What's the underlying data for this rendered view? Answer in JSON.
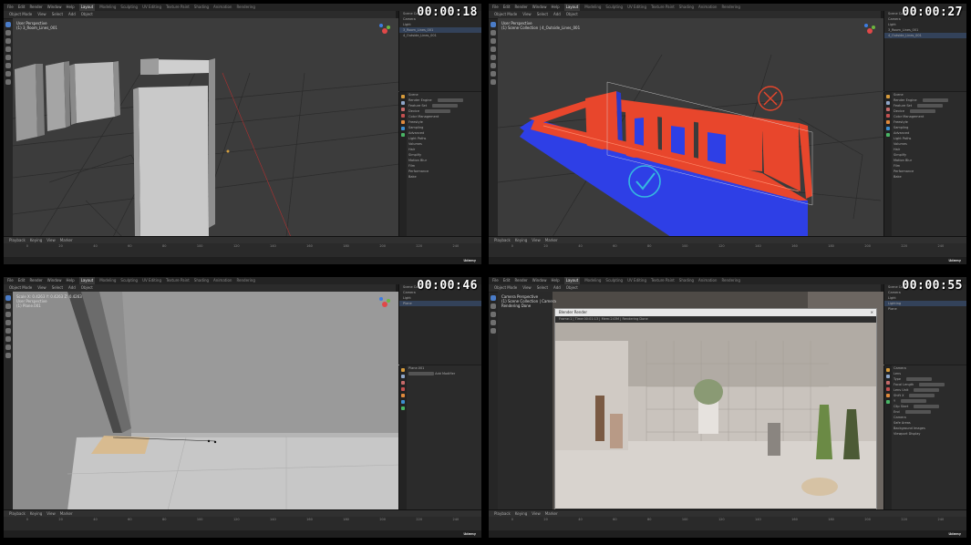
{
  "menus": [
    "File",
    "Edit",
    "Render",
    "Window",
    "Help"
  ],
  "workspaces": [
    "Layout",
    "Modeling",
    "Sculpting",
    "UV Editing",
    "Texture Paint",
    "Shading",
    "Animation",
    "Rendering",
    "Compositing",
    "Scripting"
  ],
  "viewport_header": [
    "Object Mode",
    "View",
    "Select",
    "Add",
    "Object"
  ],
  "timeline_header": [
    "Playback",
    "Keying",
    "View",
    "Marker"
  ],
  "ruler": [
    "0",
    "10",
    "20",
    "30",
    "40",
    "50",
    "60",
    "70",
    "80",
    "90",
    "100",
    "110",
    "120",
    "130",
    "140",
    "150",
    "160",
    "170",
    "180",
    "190",
    "200",
    "210",
    "220",
    "230",
    "240",
    "250"
  ],
  "udemy": "Udemy",
  "panes": [
    {
      "timestamp": "00:00:18",
      "overlay": [
        "User Perspective",
        "(1) 3_Room_Lines_001"
      ],
      "outliner": [
        "Scene Collection",
        "Camera",
        "Light",
        "3_Room_Lines_001",
        "4_Outside_Lines_001"
      ],
      "props": [
        "Scene",
        "Render Engine",
        "Feature Set",
        "Device",
        "Color Management",
        "Freestyle",
        "Sampling",
        "Advanced",
        "Light Paths",
        "Volumes",
        "Hair",
        "Simplify",
        "Motion Blur",
        "Film",
        "Performance",
        "Bake"
      ]
    },
    {
      "timestamp": "00:00:27",
      "overlay": [
        "User Perspective",
        "(1) Scene Collection | 4_Outside_Lines_001"
      ],
      "outliner": [
        "Scene Collection",
        "Camera",
        "Light",
        "3_Room_Lines_001",
        "4_Outside_Lines_001"
      ],
      "props": [
        "Scene",
        "Render Engine",
        "Feature Set",
        "Device",
        "Color Management",
        "Freestyle",
        "Sampling",
        "Advanced",
        "Light Paths",
        "Volumes",
        "Hair",
        "Simplify",
        "Motion Blur",
        "Film",
        "Performance",
        "Bake"
      ]
    },
    {
      "timestamp": "00:00:46",
      "overlay": [
        "Scale X: 0.4263  Y: 0.4263  Z: 0.4263",
        "User Perspective",
        "(1) Plane.001"
      ],
      "outliner": [
        "Scene Collection",
        "Camera",
        "Light",
        "Plane"
      ],
      "props": [
        "Plane.001",
        "Add Modifier"
      ]
    },
    {
      "timestamp": "00:00:55",
      "overlay": [
        "Camera Perspective",
        "(1) Scene Collection | Camera",
        "Rendering Done"
      ],
      "outliner": [
        "Scene Collection",
        "Camera",
        "Light",
        "Lighting",
        "Plane"
      ],
      "render_window_title": "Blender Render",
      "render_info": "Frame:1 | Time:00:01:13 | Mem:243M | Rendering Done",
      "props": [
        "Camera",
        "Lens",
        "Type",
        "Focal Length",
        "Lens Unit",
        "Shift X",
        "Y",
        "Clip Start",
        "End",
        "Camera",
        "Safe Areas",
        "Background Images",
        "Viewport Display"
      ]
    }
  ],
  "colors": {
    "accent": "#4a7cc8",
    "red_wall": "#e8462c",
    "blue_wall": "#2d3be0",
    "check": "#35b8e0"
  }
}
